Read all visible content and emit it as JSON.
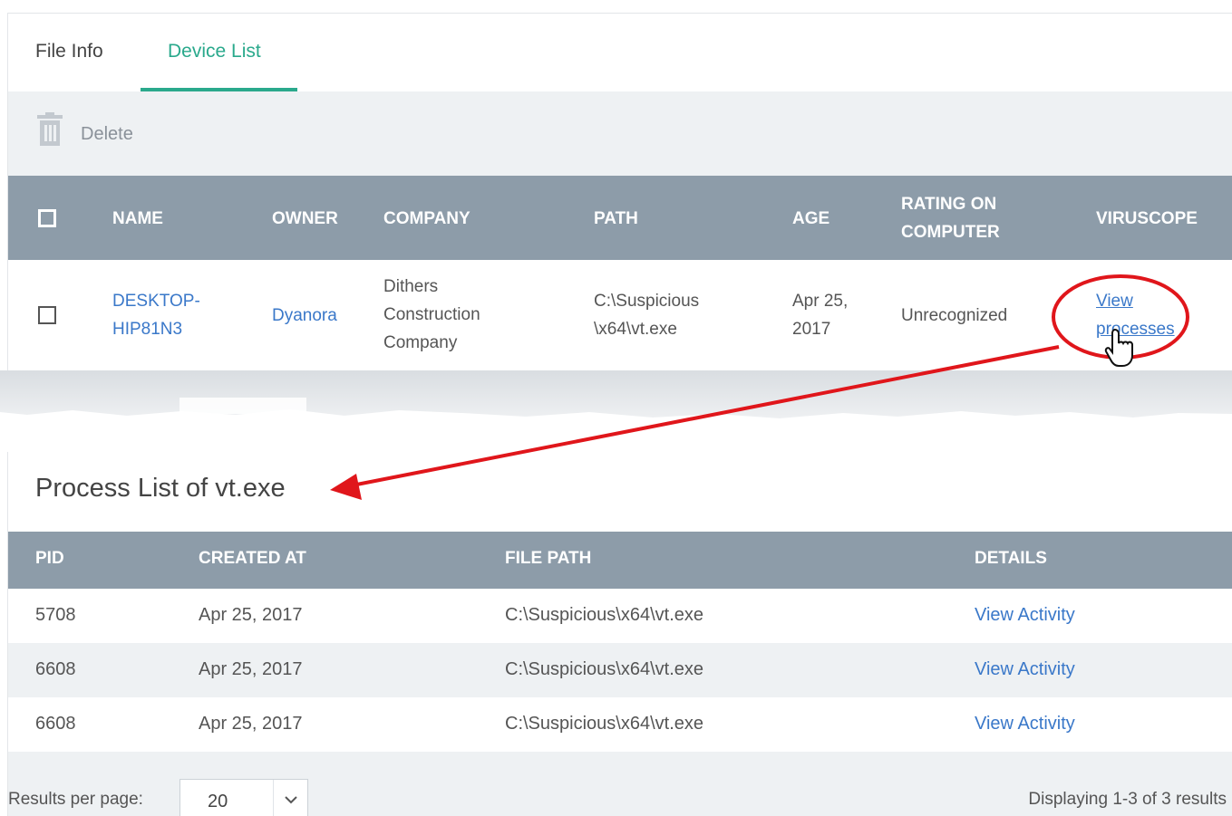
{
  "tabs": [
    {
      "label": "File Info"
    },
    {
      "label": "Device List"
    }
  ],
  "toolbar": {
    "delete_label": "Delete"
  },
  "device_table": {
    "columns": [
      "NAME",
      "OWNER",
      "COMPANY",
      "PATH",
      "AGE",
      "RATING ON COMPUTER",
      "VIRUSCOPE"
    ],
    "column_lines": {
      "rating": [
        "RATING ON",
        "COMPUTER"
      ]
    },
    "row": {
      "name": [
        "DESKTOP-",
        "HIP81N3"
      ],
      "owner": "Dyanora",
      "company": [
        "Dithers",
        "Construction",
        "Company"
      ],
      "path": [
        "C:\\Suspicious",
        "\\x64\\vt.exe"
      ],
      "age": [
        "Apr 25,",
        "2017"
      ],
      "rating": "Unrecognized",
      "viruscope": [
        "View",
        "processes"
      ]
    }
  },
  "process_list": {
    "title": "Process List of vt.exe",
    "columns": [
      "PID",
      "CREATED AT",
      "FILE PATH",
      "DETAILS"
    ],
    "rows": [
      {
        "pid": "5708",
        "created": "Apr 25, 2017",
        "path": "C:\\Suspicious\\x64\\vt.exe",
        "details": "View Activity"
      },
      {
        "pid": "6608",
        "created": "Apr 25, 2017",
        "path": "C:\\Suspicious\\x64\\vt.exe",
        "details": "View Activity"
      },
      {
        "pid": "6608",
        "created": "Apr 25, 2017",
        "path": "C:\\Suspicious\\x64\\vt.exe",
        "details": "View Activity"
      }
    ]
  },
  "pagination": {
    "results_per_page_label": "Results per page:",
    "results_per_page_value": "20",
    "display_text": "Displaying 1-3 of 3 results"
  },
  "annotation": {
    "color": "#e0161b"
  }
}
